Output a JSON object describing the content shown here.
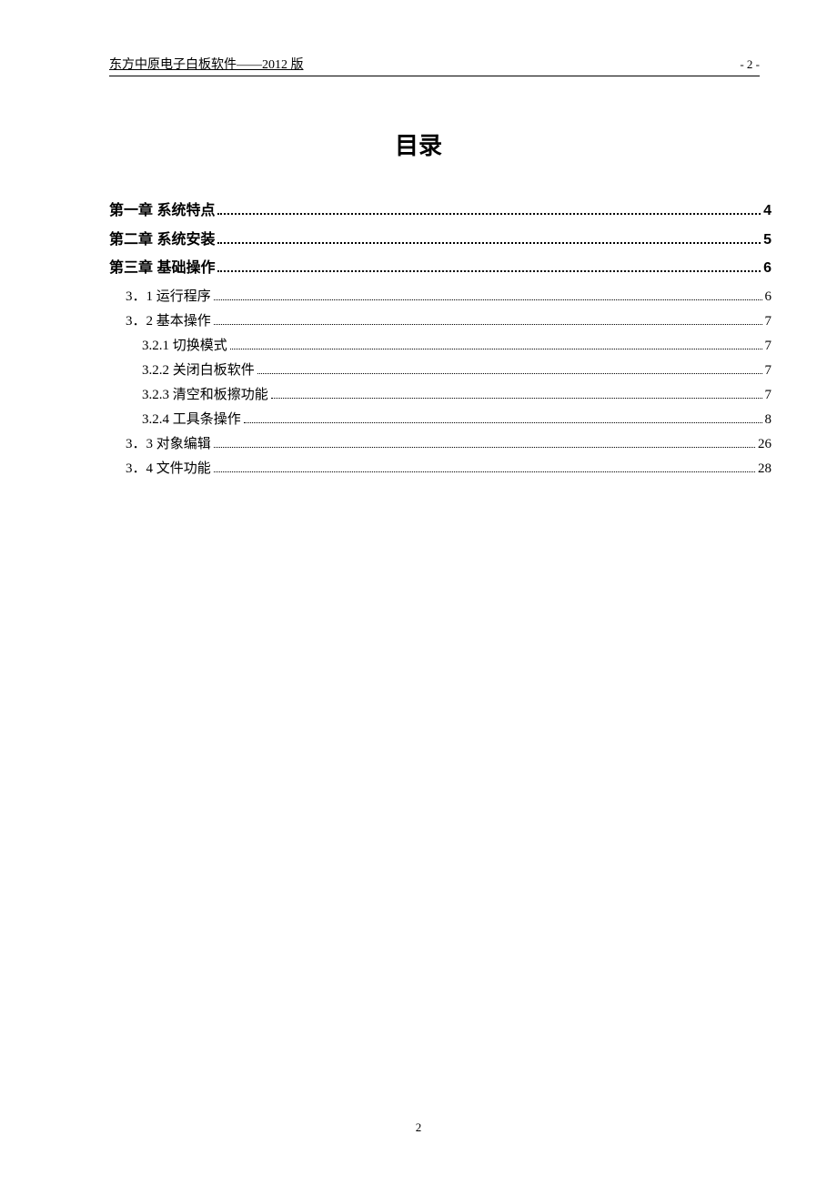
{
  "header": {
    "title": "东方中原电子白板软件——2012 版",
    "page_indicator": "- 2 -"
  },
  "toc": {
    "title": "目录",
    "entries": [
      {
        "level": 0,
        "label": "第一章 系统特点",
        "page": "4"
      },
      {
        "level": 0,
        "label": "第二章 系统安装",
        "page": "5"
      },
      {
        "level": 0,
        "label": "第三章 基础操作",
        "page": "6"
      },
      {
        "level": 1,
        "label": "3．1 运行程序",
        "page": "6"
      },
      {
        "level": 1,
        "label": "3．2 基本操作",
        "page": "7"
      },
      {
        "level": 2,
        "label": "3.2.1 切换模式",
        "page": "7"
      },
      {
        "level": 2,
        "label": "3.2.2 关闭白板软件",
        "page": "7"
      },
      {
        "level": 2,
        "label": "3.2.3 清空和板擦功能",
        "page": "7"
      },
      {
        "level": 2,
        "label": "3.2.4 工具条操作",
        "page": "8"
      },
      {
        "level": 1,
        "label": "3．3 对象编辑",
        "page": "26"
      },
      {
        "level": 1,
        "label": "3．4 文件功能",
        "page": "28"
      }
    ]
  },
  "footer": {
    "page_number": "2"
  }
}
